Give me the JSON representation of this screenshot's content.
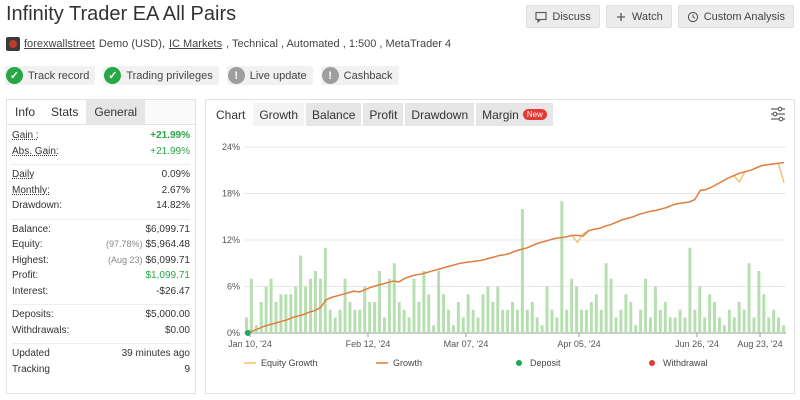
{
  "header": {
    "title": "Infinity Trader EA All Pairs",
    "actions": [
      {
        "label": "Discuss",
        "icon": "chat-icon"
      },
      {
        "label": "Watch",
        "icon": "plus-icon"
      },
      {
        "label": "Custom Analysis",
        "icon": "clock-icon"
      }
    ]
  },
  "meta": {
    "user": "forexwallstreet",
    "sep1": "Demo (USD),",
    "broker": "IC Markets",
    "rest": ", Technical , Automated , 1:500 , MetaTrader 4"
  },
  "badges": [
    {
      "label": "Track record",
      "status": "ok",
      "icon": "check-icon"
    },
    {
      "label": "Trading privileges",
      "status": "ok",
      "icon": "check-icon"
    },
    {
      "label": "Live update",
      "status": "warn",
      "icon": "exclamation-icon"
    },
    {
      "label": "Cashback",
      "status": "warn",
      "icon": "exclamation-icon"
    }
  ],
  "left": {
    "tabs": [
      "Info",
      "Stats",
      "General"
    ],
    "stats": {
      "gain_label": "Gain :",
      "gain_value": "+21.99%",
      "abs_gain_label": "Abs. Gain:",
      "abs_gain_value": "+21.99%",
      "daily_label": "Daily",
      "daily_value": "0.09%",
      "monthly_label": "Monthly:",
      "monthly_value": "2.67%",
      "drawdown_label": "Drawdown:",
      "drawdown_value": "14.82%",
      "balance_label": "Balance:",
      "balance_value": "$6,099.71",
      "equity_label": "Equity:",
      "equity_sub": "(97.78%)",
      "equity_value": "$5,964.48",
      "highest_label": "Highest:",
      "highest_sub": "(Aug 23)",
      "highest_value": "$6,099.71",
      "profit_label": "Profit:",
      "profit_value": "$1,099.71",
      "interest_label": "Interest:",
      "interest_value": "-$26.47",
      "deposits_label": "Deposits:",
      "deposits_value": "$5,000.00",
      "withdrawals_label": "Withdrawals:",
      "withdrawals_value": "$0.00",
      "updated_label": "Updated",
      "updated_value": "39 minutes ago",
      "tracking_label": "Tracking",
      "tracking_value": "9"
    }
  },
  "right": {
    "tabs": [
      "Chart",
      "Growth",
      "Balance",
      "Profit",
      "Drawdown",
      "Margin"
    ],
    "new_badge": "New",
    "filter_icon": "filter-sliders-icon"
  },
  "chart_data": {
    "type": "line",
    "x_ticks": [
      "Jan 10, '24",
      "Feb 12, '24",
      "Mar 07, '24",
      "Apr 05, '24",
      "Jun 26, '24",
      "Aug 23, '24"
    ],
    "y_ticks": [
      "0%",
      "6%",
      "12%",
      "18%",
      "24%"
    ],
    "ylim": [
      0,
      24
    ],
    "legend": [
      "Equity Growth",
      "Growth",
      "Deposit",
      "Withdrawal"
    ],
    "colors": {
      "equity": "#f5c06a",
      "growth": "#e07a3e",
      "deposit": "#1aa85a",
      "withdrawal": "#e53935",
      "bars": "#b6dfb0",
      "grid": "#e8e8e8"
    },
    "growth_series": [
      0,
      0.3,
      0.6,
      0.9,
      1.1,
      1.3,
      1.5,
      1.7,
      2.0,
      2.2,
      2.4,
      2.7,
      2.9,
      3.3,
      4.3,
      4.6,
      4.8,
      5.0,
      5.2,
      5.4,
      5.3,
      5.6,
      5.9,
      6.1,
      6.3,
      6.5,
      6.7,
      6.6,
      7.0,
      7.3,
      7.5,
      7.6,
      7.8,
      8.0,
      8.2,
      8.4,
      8.6,
      8.8,
      9.0,
      9.1,
      9.2,
      9.3,
      9.4,
      9.6,
      9.8,
      10.0,
      10.1,
      10.3,
      10.6,
      10.8,
      11.0,
      11.3,
      11.6,
      11.8,
      12.0,
      12.2,
      12.3,
      12.4,
      12.6,
      12.6,
      12.5,
      13.2,
      13.4,
      13.5,
      13.8,
      14.0,
      14.3,
      14.6,
      14.8,
      15.0,
      15.3,
      15.5,
      15.7,
      15.8,
      16.0,
      16.2,
      16.5,
      16.7,
      16.8,
      16.9,
      17.2,
      18.4,
      18.5,
      18.8,
      19.2,
      19.6,
      20.0,
      20.3,
      20.6,
      20.8,
      21.0,
      21.3,
      21.6,
      21.7,
      21.8,
      21.9,
      21.99
    ],
    "equity_dips": [
      {
        "i": 59,
        "v": 11.7
      },
      {
        "i": 60,
        "v": 12.8
      },
      {
        "i": 88,
        "v": 19.5
      },
      {
        "i": 96,
        "v": 19.4
      }
    ],
    "bars": [
      2,
      7,
      1,
      4,
      6,
      7,
      4,
      5,
      5,
      5,
      6,
      10,
      6,
      7,
      8,
      7,
      11,
      3,
      2,
      3,
      7,
      4,
      3,
      3,
      6,
      4,
      4,
      8,
      2,
      7,
      9,
      4,
      3,
      2,
      7,
      4,
      8,
      5,
      1,
      8,
      5,
      3,
      1,
      4,
      2,
      5,
      3,
      2,
      5,
      6,
      4,
      6,
      3,
      3,
      4,
      3,
      16,
      3,
      4,
      2,
      1,
      6,
      3,
      2,
      17,
      3,
      7,
      6,
      3,
      3,
      4,
      5,
      3,
      9,
      7,
      2,
      3,
      5,
      4,
      1,
      3,
      7,
      2,
      6,
      3,
      4,
      2,
      2,
      3,
      2,
      11,
      3,
      6,
      2,
      5,
      4,
      2,
      1,
      3,
      2,
      4,
      3,
      9,
      2,
      8,
      5,
      2,
      3,
      2,
      1
    ]
  }
}
